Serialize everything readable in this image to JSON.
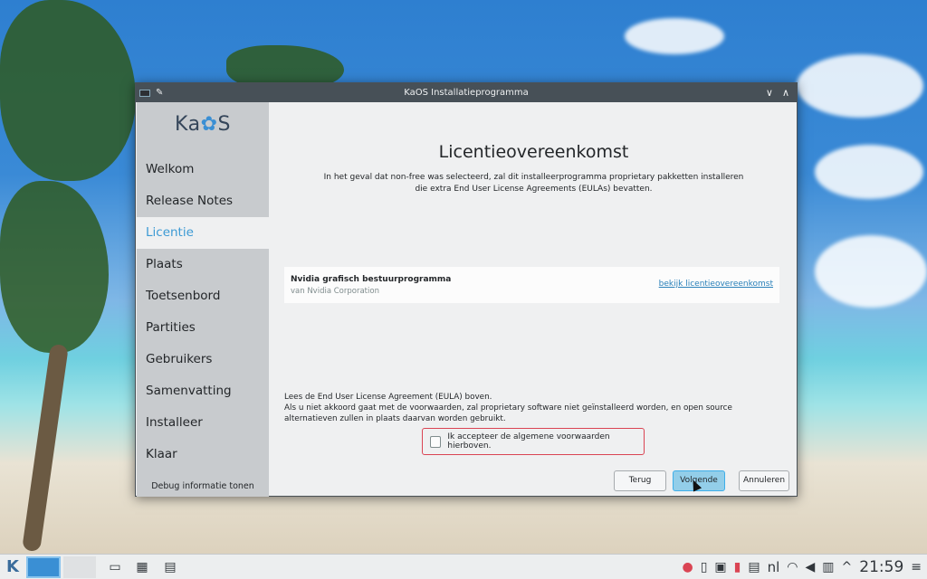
{
  "window": {
    "title": "KaOS Installatieprogramma",
    "minimize_glyph": "∨",
    "maximize_glyph": "∧"
  },
  "sidebar": {
    "logo_prefix": "Ka",
    "logo_suffix": "S",
    "items": [
      {
        "label": "Welkom"
      },
      {
        "label": "Release Notes"
      },
      {
        "label": "Licentie",
        "active": true
      },
      {
        "label": "Plaats"
      },
      {
        "label": "Toetsenbord"
      },
      {
        "label": "Partities"
      },
      {
        "label": "Gebruikers"
      },
      {
        "label": "Samenvatting"
      },
      {
        "label": "Installeer"
      },
      {
        "label": "Klaar"
      }
    ],
    "debug_label": "Debug informatie tonen"
  },
  "main": {
    "title": "Licentieovereenkomst",
    "intro_line1": "In het geval dat non-free was selecteerd, zal dit installeerprogramma proprietary pakketten installeren",
    "intro_line2": "die extra End User License Agreements (EULAs) bevatten.",
    "license": {
      "name": "Nvidia grafisch bestuurprogramma",
      "vendor": "van Nvidia Corporation",
      "link": "bekijk licentieovereenkomst"
    },
    "eula_line1": "Lees de End User License Agreement (EULA) boven.",
    "eula_line2": "Als u niet akkoord gaat met de voorwaarden, zal proprietary software niet geïnstalleerd worden, en open source alternatieven zullen in plaats daarvan worden gebruikt.",
    "accept_label": "Ik accepteer de algemene voorwaarden hierboven.",
    "accept_checked": false,
    "buttons": {
      "back": "Terug",
      "next": "Volgende",
      "cancel": "Annuleren"
    }
  },
  "taskbar": {
    "launcher_icon": "kaos-launcher-icon",
    "tasks": [
      "file-manager-icon",
      "app-grid-icon",
      "installer-icon"
    ],
    "tray": [
      "user-icon",
      "clipboard-icon",
      "usb-icon",
      "battery-icon",
      "printer-icon"
    ],
    "language": "nl",
    "tray2": [
      "ghost-icon",
      "volume-icon",
      "network-icon",
      "expand-tray-icon"
    ],
    "clock": "21:59",
    "menu_icon": "hamburger-icon"
  },
  "colors": {
    "accent": "#3daee9",
    "active_nav_text": "#3c9ad4",
    "error_border": "#da4453",
    "link": "#2980b9"
  }
}
